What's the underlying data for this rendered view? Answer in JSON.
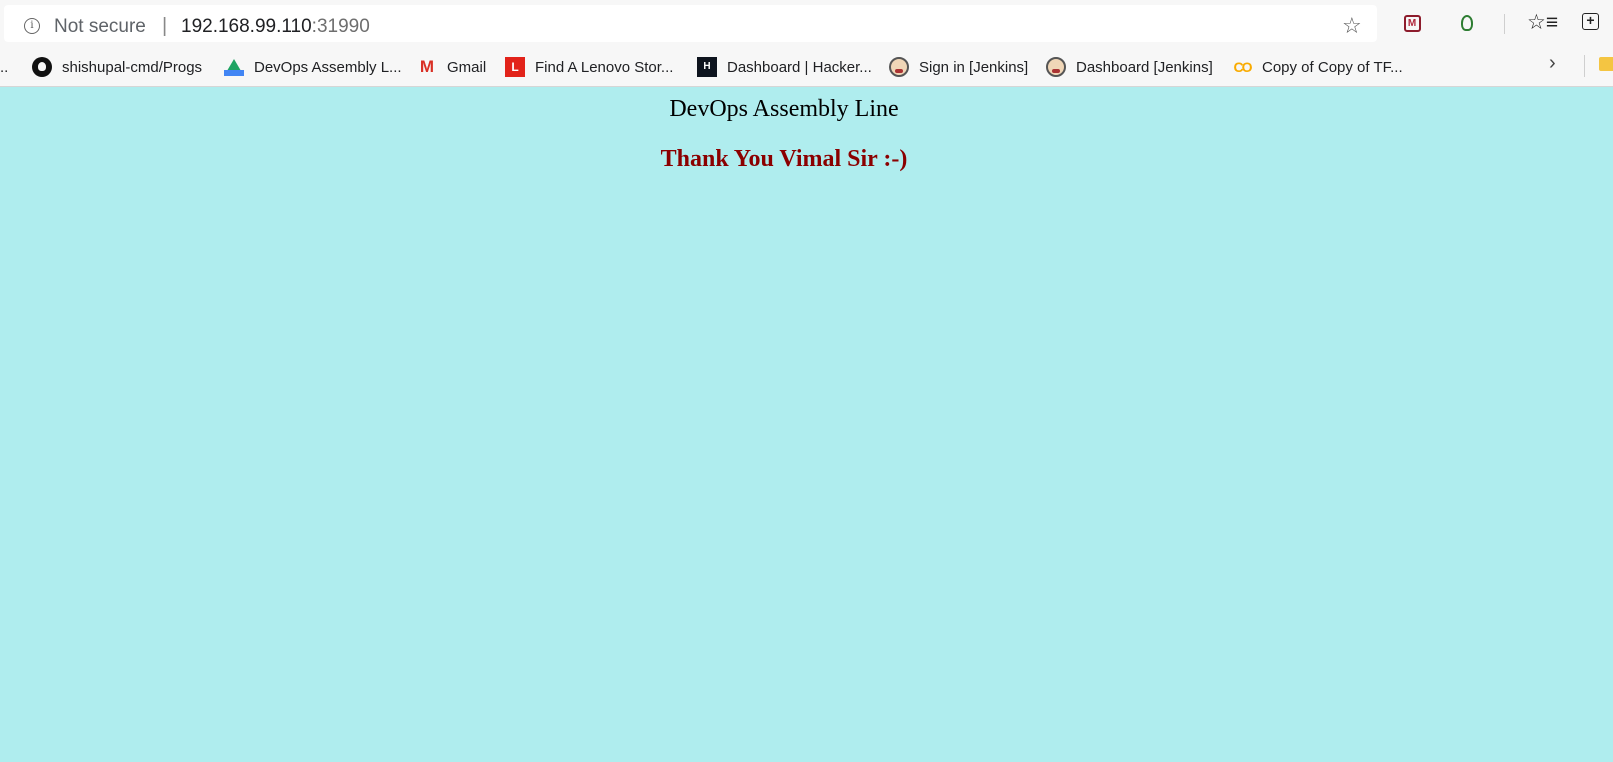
{
  "address_bar": {
    "security_label": "Not secure",
    "separator": "|",
    "url_host": "192.168.99.110",
    "url_port": ":31990"
  },
  "icons": {
    "info": "i",
    "star": "☆",
    "favorites": "☆≡",
    "collections": "+",
    "chevron": "›",
    "ext_mcafee": "M"
  },
  "bookmarks": {
    "overflow_left": "..",
    "items": [
      {
        "label": "shishupal-cmd/Progs",
        "icon": "github-icon"
      },
      {
        "label": "DevOps Assembly L...",
        "icon": "google-drive-icon"
      },
      {
        "label": "Gmail",
        "icon": "gmail-icon",
        "glyph": "M"
      },
      {
        "label": "Find A Lenovo Stor...",
        "icon": "lenovo-icon",
        "glyph": "L"
      },
      {
        "label": "Dashboard | Hacker...",
        "icon": "hackerrank-icon",
        "glyph": "H"
      },
      {
        "label": "Sign in [Jenkins]",
        "icon": "jenkins-icon"
      },
      {
        "label": "Dashboard [Jenkins]",
        "icon": "jenkins-icon"
      },
      {
        "label": "Copy of Copy of TF...",
        "icon": "colab-icon",
        "glyph": "CO"
      }
    ]
  },
  "page": {
    "heading": "DevOps Assembly Line",
    "message": "Thank You Vimal Sir :-)",
    "background": "#afedee",
    "message_color": "#8b0000"
  }
}
